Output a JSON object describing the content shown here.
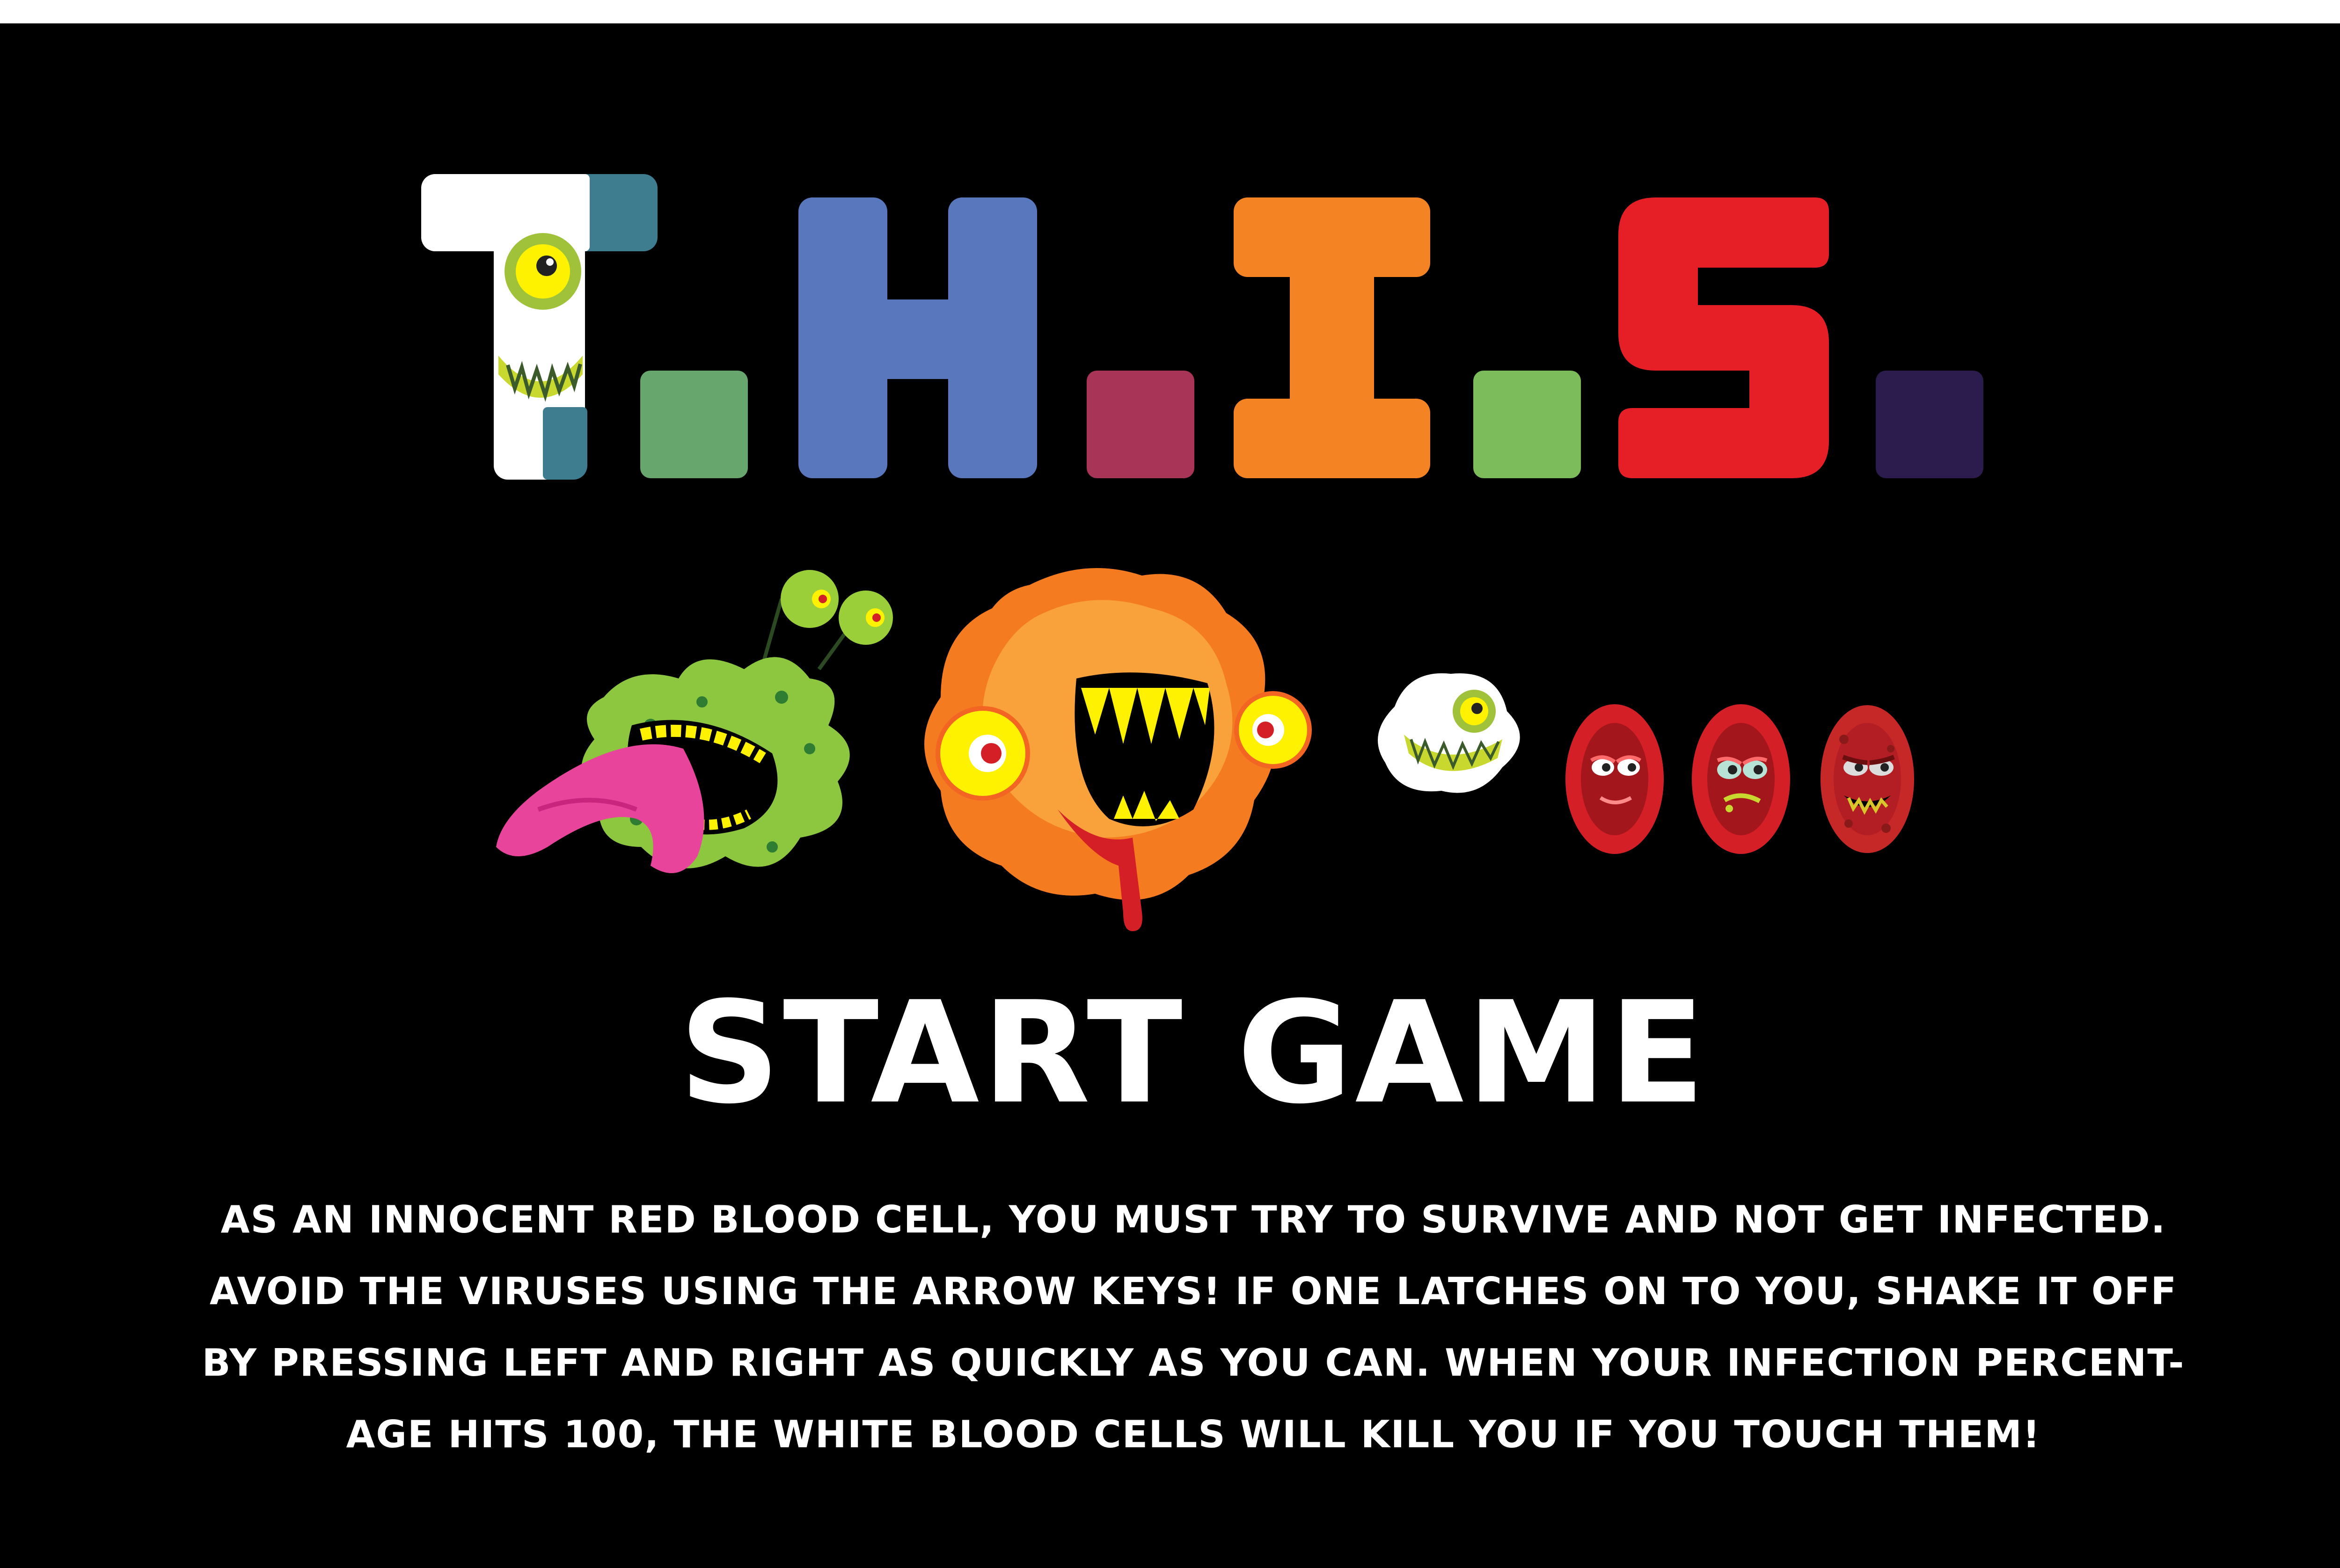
{
  "title": {
    "letters": [
      "T",
      "H",
      "I",
      "S"
    ],
    "colors": {
      "t": "#3e7c8f",
      "h": "#5977bc",
      "i": "#f48423",
      "s": "#e61f27",
      "dot1": "#67a66d",
      "dot2": "#a83457",
      "dot3": "#7cbc5a",
      "dot4": "#2b1c4d"
    }
  },
  "characters": [
    {
      "name": "green-virus",
      "icon": "green-virus-icon"
    },
    {
      "name": "orange-virus",
      "icon": "orange-virus-icon"
    },
    {
      "name": "white-blood-cell",
      "icon": "white-blood-cell-icon"
    },
    {
      "name": "red-blood-cell-healthy",
      "icon": "red-blood-cell-icon"
    },
    {
      "name": "red-blood-cell-sick",
      "icon": "red-blood-cell-sick-icon"
    },
    {
      "name": "red-blood-cell-infected",
      "icon": "red-blood-cell-infected-icon"
    }
  ],
  "menu": {
    "start_label": "START GAME"
  },
  "instructions": {
    "lines": [
      "As an innocent red blood cell, you must try to survive and not get infected.",
      "Avoid the viruses using the arrow keys! If one latches on to you, shake it off",
      "by pressing left and right as quickly as you can. When your infection percent-",
      "age hits 100, the white blood cells will kill you if you touch them!"
    ]
  }
}
